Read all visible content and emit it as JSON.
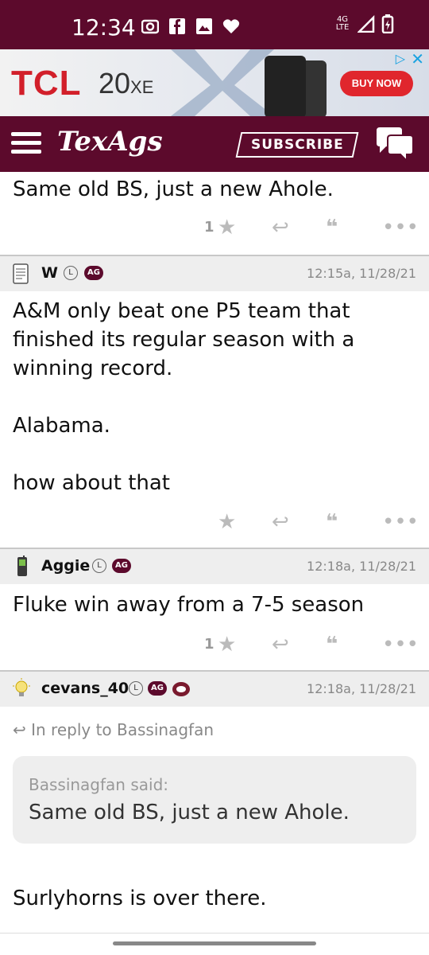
{
  "status": {
    "time": "12:34",
    "network": "4G LTE"
  },
  "ad": {
    "brand": "TCL",
    "model_num": "20",
    "model_suffix": "XE",
    "cta": "BUY NOW"
  },
  "header": {
    "logo": "TexAgs",
    "subscribe": "SUBSCRIBE"
  },
  "posts": [
    {
      "text": "Same old BS, just a new Ahole.",
      "likes": "1"
    },
    {
      "user": "W",
      "badge_l": "L",
      "badge_ag": "AG",
      "time": "12:15a, 11/28/21",
      "text": "A&M only beat one P5 team that\nfinished its regular season with a\nwinning record.\n\nAlabama.\n\nhow about that",
      "likes": ""
    },
    {
      "user": "Aggie",
      "badge_l": "L",
      "badge_ag": "AG",
      "time": "12:18a, 11/28/21",
      "text": "Fluke win away from a 7-5 season",
      "likes": "1"
    },
    {
      "user": "cevans_40",
      "badge_l": "L",
      "badge_ag": "AG",
      "time": "12:18a, 11/28/21",
      "reply_to": "In reply to Bassinagfan",
      "quote_author": "Bassinagfan said:",
      "quote_text": "Same old BS, just a new Ahole.",
      "text": "Surlyhorns is over there."
    }
  ],
  "colors": {
    "maroon": "#5c0a2c",
    "ad_red": "#e0262d"
  }
}
